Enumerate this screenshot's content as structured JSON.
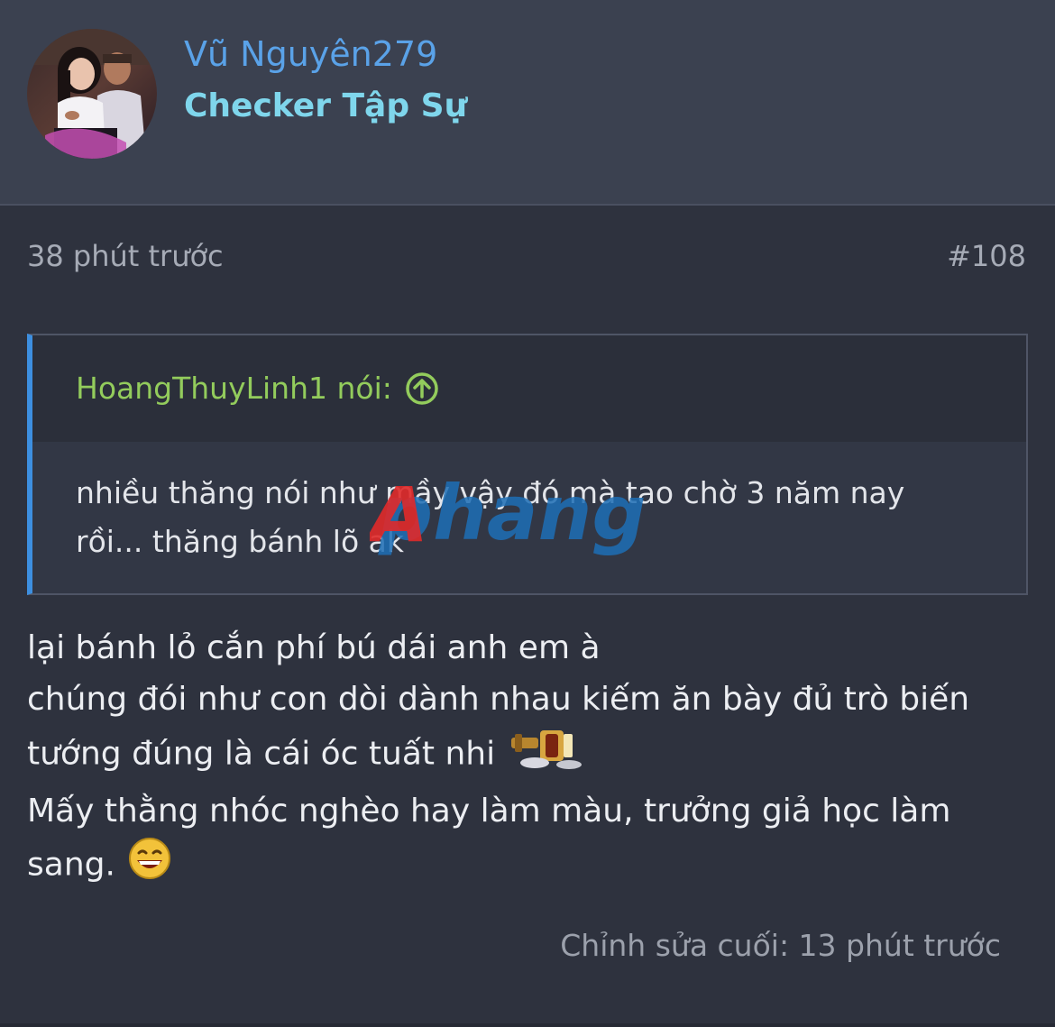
{
  "user": {
    "name": "Vũ Nguyên279",
    "title": "Checker Tập Sự"
  },
  "post": {
    "time": "38 phút trước",
    "number": "#108"
  },
  "quote": {
    "author_label": "HoangThuyLinh1 nói:",
    "text_line1": "nhiều thăng nói như mầy vậy đó mà tao chờ 3 năm nay",
    "text_line2": "rồi... thăng bánh lõ ak"
  },
  "watermark": {
    "text": "Aphang"
  },
  "body": {
    "lines": [
      "lại bánh lỏ cắn phí bú dái anh em à",
      "chúng đói như con dòi dành nhau kiếm ăn bày đủ trò biến",
      "tướng đúng là cái óc tuất nhi",
      "Mấy thằng nhóc nghèo hay làm màu, trưởng giả học làm",
      "sang."
    ]
  },
  "footer": {
    "edited": "Chỉnh sửa cuối: 13 phút trước"
  },
  "colors": {
    "username": "#5aa2e8",
    "user_title": "#7fd6ec",
    "quote_author": "#93cc5c",
    "quote_border": "#3d8fe0",
    "header_bg": "#3b4150",
    "body_bg": "#2e323e"
  },
  "icons": {
    "quote_jump": "arrow-up-circle-icon",
    "emoji_1": "gavel-emoji-icon",
    "emoji_2": "laughing-emoji-icon"
  }
}
